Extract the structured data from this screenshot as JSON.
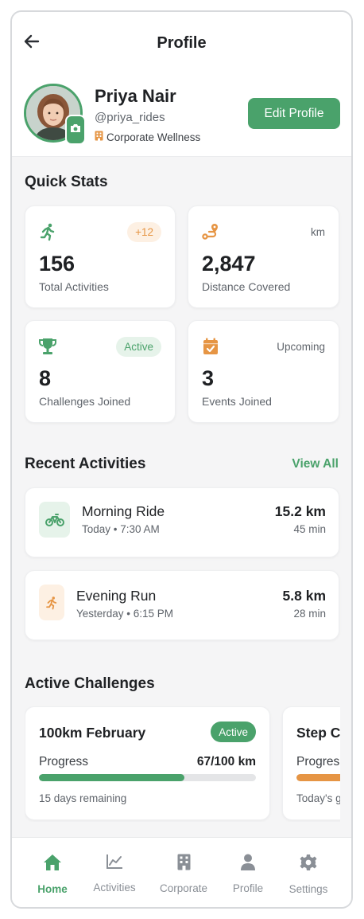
{
  "header": {
    "title": "Profile"
  },
  "profile": {
    "name": "Priya Nair",
    "handle": "@priya_rides",
    "organization": "Corporate Wellness",
    "edit_label": "Edit Profile"
  },
  "quick_stats": {
    "title": "Quick Stats",
    "items": [
      {
        "icon": "running-icon",
        "badge": "+12",
        "value": "156",
        "label": "Total Activities"
      },
      {
        "icon": "route-icon",
        "badge": "km",
        "value": "2,847",
        "label": "Distance Covered"
      },
      {
        "icon": "trophy-icon",
        "badge": "Active",
        "value": "8",
        "label": "Challenges Joined"
      },
      {
        "icon": "calendar-check-icon",
        "badge": "Upcoming",
        "value": "3",
        "label": "Events Joined"
      }
    ]
  },
  "recent": {
    "title": "Recent Activities",
    "view_all": "View All",
    "items": [
      {
        "icon": "bicycle-icon",
        "title": "Morning Ride",
        "subtitle": "Today • 7:30 AM",
        "distance": "15.2 km",
        "duration": "45 min"
      },
      {
        "icon": "running-icon",
        "title": "Evening Run",
        "subtitle": "Yesterday • 6:15 PM",
        "distance": "5.8 km",
        "duration": "28 min"
      }
    ]
  },
  "challenges": {
    "title": "Active Challenges",
    "items": [
      {
        "title": "100km February",
        "badge": "Active",
        "progress_label": "Progress",
        "progress_value": "67/100 km",
        "progress": 0.67,
        "footer": "15 days remaining",
        "color": "#4aa26b"
      },
      {
        "title": "Step C",
        "progress_label": "Progres",
        "progress": 0.5,
        "footer": "Today's g",
        "color": "#e69544"
      }
    ]
  },
  "nav": {
    "items": [
      {
        "label": "Home",
        "icon": "home-icon",
        "active": true
      },
      {
        "label": "Activities",
        "icon": "chart-line-icon",
        "active": false
      },
      {
        "label": "Corporate",
        "icon": "building-icon",
        "active": false
      },
      {
        "label": "Profile",
        "icon": "user-icon",
        "active": false
      },
      {
        "label": "Settings",
        "icon": "gear-icon",
        "active": false
      }
    ]
  },
  "colors": {
    "primary": "#4aa26b",
    "accent": "#e69544"
  }
}
